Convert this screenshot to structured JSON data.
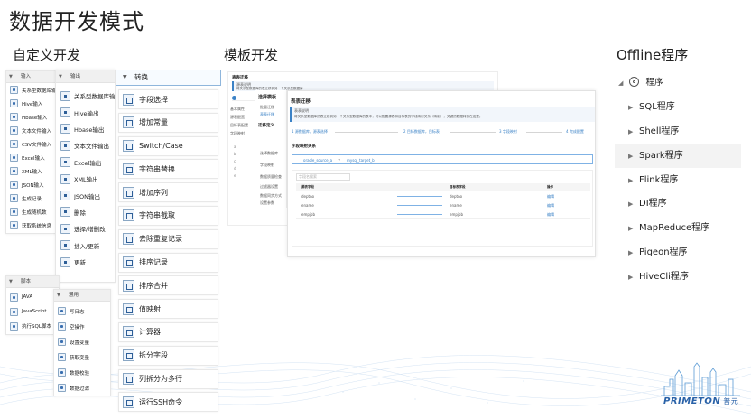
{
  "slide_title": "数据开发模式",
  "sections": {
    "custom": "自定义开发",
    "template": "模板开发",
    "offline": "Offline程序"
  },
  "input_panel": {
    "title": "输入",
    "items": [
      "关系型数据库输入",
      "Hive输入",
      "Hbase输入",
      "文本文件输入",
      "CSV文件输入",
      "Excel输入",
      "XML输入",
      "JSON输入",
      "生成记录",
      "生成随机数",
      "获取系统信息"
    ]
  },
  "output_panel": {
    "title": "输出",
    "items": [
      "关系型数据库输出",
      "Hive输出",
      "Hbase输出",
      "文本文件输出",
      "Excel输出",
      "XML输出",
      "JSON输出",
      "删除",
      "选择/增删改",
      "插入/更新",
      "更新"
    ]
  },
  "transform_panel": {
    "title": "转换",
    "items": [
      "字段选择",
      "增加常量",
      "Switch/Case",
      "字符串替换",
      "增加序列",
      "字符串截取",
      "去除重复记录",
      "排序记录",
      "排序合并",
      "值映射",
      "计算器",
      "拆分字段",
      "列拆分为多行",
      "运行SSH命令"
    ]
  },
  "script_panel": {
    "title": "脚本",
    "items": [
      "JAVA",
      "JavaScript",
      "执行SQL脚本"
    ]
  },
  "common_panel": {
    "title": "通用",
    "items": [
      "写日志",
      "空操作",
      "设置变量",
      "获取变量",
      "数据校验",
      "数据过滤"
    ]
  },
  "template_shot": {
    "back_title": "表表迁移",
    "back_sub": "源表说明",
    "back_desc": "将关系型数据库的表迁移到另一个关系型数据库",
    "back_nav": [
      "基本属性",
      "源表配置",
      "目标表配置",
      "字段映射"
    ],
    "back_tables": [
      "a",
      "b",
      "c",
      "d",
      "e"
    ],
    "mid_nav": [
      "选择模板",
      "批量迁移",
      "表表迁移",
      "迁移定义",
      "选择数据库",
      "字段映射",
      "数据质量检查",
      "过滤器设置",
      "数据同步方式",
      "设置参数"
    ],
    "front_title": "表表迁移",
    "front_box_title": "表表说明",
    "front_box_desc": "将关系型数据库的表迁移到另一个关系型数据库的表中，可以配置源表和目标表的字段映射关系（映射），关键的数据转换在这里。",
    "steps": [
      "1  源数据库，源表选择",
      "2  目标数据库，目标表",
      "3  字段映射",
      "4  完成配置"
    ],
    "mapping_title": "字段映射关系",
    "source_tag": "oracle_source_a",
    "target_tag": "mysql_target_b",
    "search_placeholder": "字段名搜索",
    "columns": [
      "源表字段",
      "目标表字段",
      "操作"
    ],
    "rows": [
      {
        "src": "deptno",
        "dst": "deptno",
        "op": "编辑"
      },
      {
        "src": "ename",
        "dst": "ename",
        "op": "编辑"
      },
      {
        "src": "empjob",
        "dst": "empjob",
        "op": "编辑"
      }
    ]
  },
  "offline_menu": {
    "root": "程序",
    "items": [
      "SQL程序",
      "Shell程序",
      "Spark程序",
      "Flink程序",
      "DI程序",
      "MapReduce程序",
      "Pigeon程序",
      "HiveCli程序"
    ],
    "active_index": 2
  },
  "logo": {
    "brand": "PRIMETON",
    "cn": "普元"
  }
}
